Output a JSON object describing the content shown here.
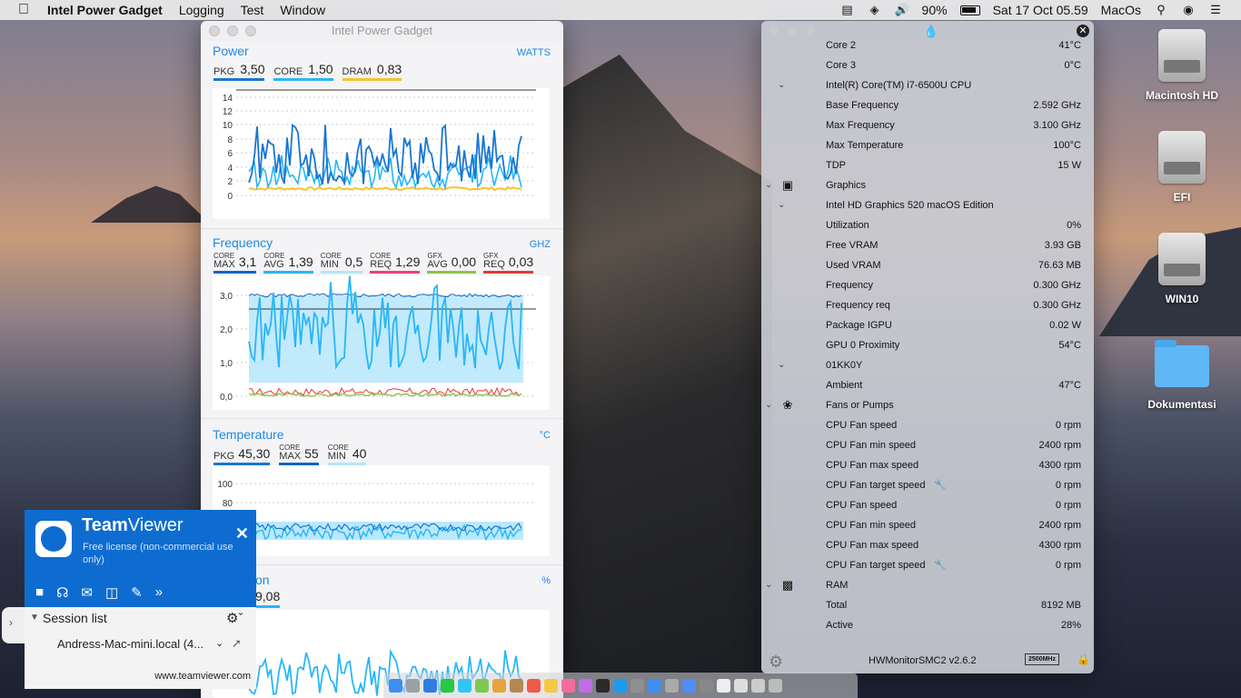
{
  "menubar": {
    "app_name": "Intel Power Gadget",
    "menus": [
      "Logging",
      "Test",
      "Window"
    ],
    "battery_pct": "90%",
    "datetime": "Sat 17 Oct  05.59",
    "user": "MacOs"
  },
  "ipg": {
    "title": "Intel Power Gadget",
    "power": {
      "title": "Power",
      "unit": "WATTS",
      "metrics": [
        {
          "label": "PKG",
          "value": "3,50",
          "color": "#1976d2"
        },
        {
          "label": "CORE",
          "value": "1,50",
          "color": "#29b6f6"
        },
        {
          "label": "DRAM",
          "value": "0,83",
          "color": "#fbc02d"
        }
      ],
      "yticks": [
        "14",
        "12",
        "10",
        "8",
        "6",
        "4",
        "2",
        "0"
      ]
    },
    "frequency": {
      "title": "Frequency",
      "unit": "GHZ",
      "metrics": [
        {
          "top": "CORE",
          "label": "MAX",
          "value": "3,1",
          "color": "#1565c0"
        },
        {
          "top": "CORE",
          "label": "AVG",
          "value": "1,39",
          "color": "#29b6f6"
        },
        {
          "top": "CORE",
          "label": "MIN",
          "value": "0,5",
          "color": "#b3e5fc"
        },
        {
          "top": "CORE",
          "label": "REQ",
          "value": "1,29",
          "color": "#ec407a"
        },
        {
          "top": "GFX",
          "label": "AVG",
          "value": "0,00",
          "color": "#8bc34a"
        },
        {
          "top": "GFX",
          "label": "REQ",
          "value": "0,03",
          "color": "#e53935"
        }
      ],
      "yticks": [
        "3,0",
        "2,0",
        "1,0",
        "0,0"
      ]
    },
    "temperature": {
      "title": "Temperature",
      "unit": "°C",
      "metrics": [
        {
          "label": "PKG",
          "value": "45,30",
          "color": "#1976d2"
        },
        {
          "top": "CORE",
          "label": "MAX",
          "value": "55",
          "color": "#1565c0"
        },
        {
          "top": "CORE",
          "label": "MIN",
          "value": "40",
          "color": "#b3e5fc"
        }
      ],
      "yticks": [
        "100",
        "80"
      ]
    },
    "utilization": {
      "title_visible": "on",
      "unit": "%",
      "value_visible": "9,08"
    }
  },
  "hwm": {
    "rows": [
      {
        "kind": "item",
        "label": "Core 2",
        "value": "41°C"
      },
      {
        "kind": "item",
        "label": "Core 3",
        "value": "0°C"
      },
      {
        "kind": "group",
        "label": "Intel(R) Core(TM) i7-6500U CPU",
        "value": ""
      },
      {
        "kind": "item",
        "label": "Base Frequency",
        "value": "2.592 GHz"
      },
      {
        "kind": "item",
        "label": "Max Frequency",
        "value": "3.100 GHz"
      },
      {
        "kind": "item",
        "label": "Max Temperature",
        "value": "100°C"
      },
      {
        "kind": "item",
        "label": "TDP",
        "value": "15 W"
      },
      {
        "kind": "category",
        "label": "Graphics",
        "value": "",
        "icon": "display-icon"
      },
      {
        "kind": "group",
        "label": "Intel HD Graphics 520 macOS Edition",
        "value": ""
      },
      {
        "kind": "item",
        "label": "Utilization",
        "value": "0%"
      },
      {
        "kind": "item",
        "label": "Free VRAM",
        "value": "3.93 GB"
      },
      {
        "kind": "item",
        "label": "Used VRAM",
        "value": "76.63 MB"
      },
      {
        "kind": "item",
        "label": "Frequency",
        "value": "0.300 GHz"
      },
      {
        "kind": "item",
        "label": "Frequency req",
        "value": "0.300 GHz"
      },
      {
        "kind": "item",
        "label": "Package IGPU",
        "value": "0.02 W"
      },
      {
        "kind": "item",
        "label": "GPU 0 Proximity",
        "value": "54°C"
      },
      {
        "kind": "group",
        "label": "01KK0Y",
        "value": ""
      },
      {
        "kind": "item",
        "label": "Ambient",
        "value": "47°C"
      },
      {
        "kind": "category",
        "label": "Fans or Pumps",
        "value": "",
        "icon": "fan-icon"
      },
      {
        "kind": "item",
        "label": "CPU Fan speed",
        "value": "0 rpm"
      },
      {
        "kind": "item",
        "label": "CPU Fan min speed",
        "value": "2400 rpm"
      },
      {
        "kind": "item",
        "label": "CPU Fan max speed",
        "value": "4300 rpm"
      },
      {
        "kind": "item",
        "label": "CPU Fan target speed",
        "value": "0 rpm",
        "wrench": true
      },
      {
        "kind": "item",
        "label": "CPU Fan speed",
        "value": "0 rpm"
      },
      {
        "kind": "item",
        "label": "CPU Fan min speed",
        "value": "2400 rpm"
      },
      {
        "kind": "item",
        "label": "CPU Fan max speed",
        "value": "4300 rpm"
      },
      {
        "kind": "item",
        "label": "CPU Fan target speed",
        "value": "0 rpm",
        "wrench": true
      },
      {
        "kind": "category",
        "label": "RAM",
        "value": "",
        "icon": "ram-icon"
      },
      {
        "kind": "item",
        "label": "Total",
        "value": "8192 MB"
      },
      {
        "kind": "item",
        "label": "Active",
        "value": "28%"
      }
    ],
    "footer": {
      "version": "HWMonitorSMC2 v2.6.2",
      "badge": "2500MHz"
    }
  },
  "desktop_icons": [
    {
      "label": "Macintosh HD",
      "kind": "disk"
    },
    {
      "label": "EFI",
      "kind": "disk"
    },
    {
      "label": "WIN10",
      "kind": "disk"
    },
    {
      "label": "Dokumentasi",
      "kind": "folder"
    }
  ],
  "teamviewer": {
    "brand_bold": "Team",
    "brand_light": "Viewer",
    "license": "Free license (non-commercial use only)",
    "session_list_title": "Session list",
    "session_item": "Andress-Mac-mini.local (4...",
    "website": "www.teamviewer.com"
  },
  "colors": {
    "accent": "#1e88e5",
    "teamviewer_blue": "#0e6cd0"
  }
}
